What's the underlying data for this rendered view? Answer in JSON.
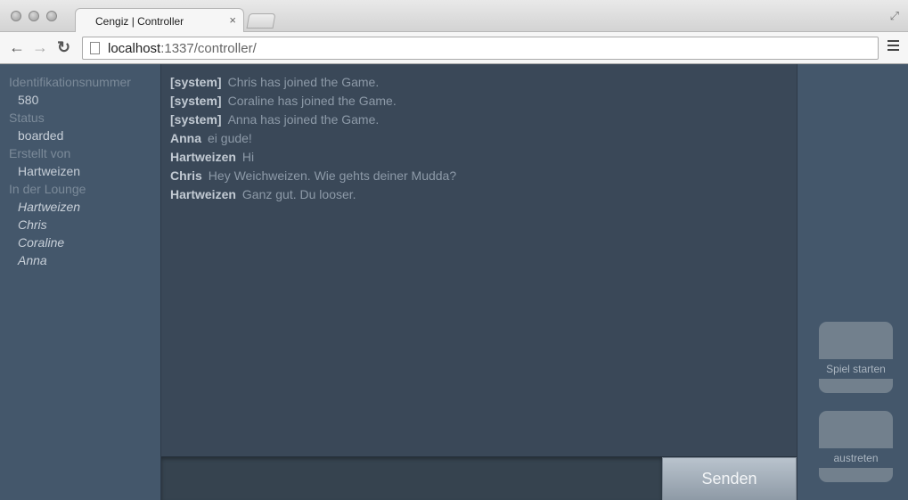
{
  "browser": {
    "tab_title": "Cengiz | Controller",
    "tab_close": "×",
    "url_host": "localhost",
    "url_path": ":1337/controller/",
    "back_icon": "←",
    "forward_icon": "→",
    "reload_icon": "↻",
    "fullscreen_icon": "⤢"
  },
  "sidebar": {
    "id_label": "Identifikationsnummer",
    "id_value": "580",
    "status_label": "Status",
    "status_value": "boarded",
    "created_label": "Erstellt von",
    "created_value": "Hartweizen",
    "lounge_label": "In der Lounge",
    "lounge_members": [
      "Hartweizen",
      "Chris",
      "Coraline",
      "Anna"
    ]
  },
  "chat": {
    "messages": [
      {
        "author": "[system]",
        "text": "Chris has joined the Game."
      },
      {
        "author": "[system]",
        "text": "Coraline has joined the Game."
      },
      {
        "author": "[system]",
        "text": "Anna has joined the Game."
      },
      {
        "author": "Anna",
        "text": "ei gude!"
      },
      {
        "author": "Hartweizen",
        "text": "Hi"
      },
      {
        "author": "Chris",
        "text": "Hey Weichweizen. Wie gehts deiner Mudda?"
      },
      {
        "author": "Hartweizen",
        "text": "Ganz gut. Du looser."
      }
    ],
    "input_value": "",
    "send_label": "Senden"
  },
  "actions": {
    "start_label": "Spiel starten",
    "leave_label": "austreten"
  }
}
